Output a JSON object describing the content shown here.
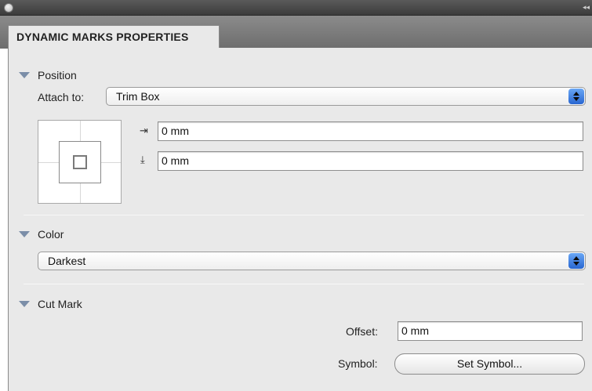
{
  "panel": {
    "tab_label": "DYNAMIC MARKS PROPERTIES",
    "collapse_glyph": "◂◂"
  },
  "position": {
    "header": "Position",
    "attach_label": "Attach to:",
    "attach_value": "Trim Box",
    "horizontal_offset_icon": "arrow-right-from-bar-icon",
    "horizontal_offset": "0 mm",
    "vertical_offset_icon": "arrow-down-to-bar-icon",
    "vertical_offset": "0 mm",
    "icons": {
      "horizontal": "⇥",
      "vertical": "⤓"
    }
  },
  "color": {
    "header": "Color",
    "value": "Darkest"
  },
  "cut_mark": {
    "header": "Cut Mark",
    "offset_label": "Offset:",
    "offset_value": "0 mm",
    "symbol_label": "Symbol:",
    "symbol_button": "Set Symbol..."
  },
  "colors": {
    "select_accent": "#2866d1",
    "disclosure_triangle": "#7b8ea8"
  }
}
